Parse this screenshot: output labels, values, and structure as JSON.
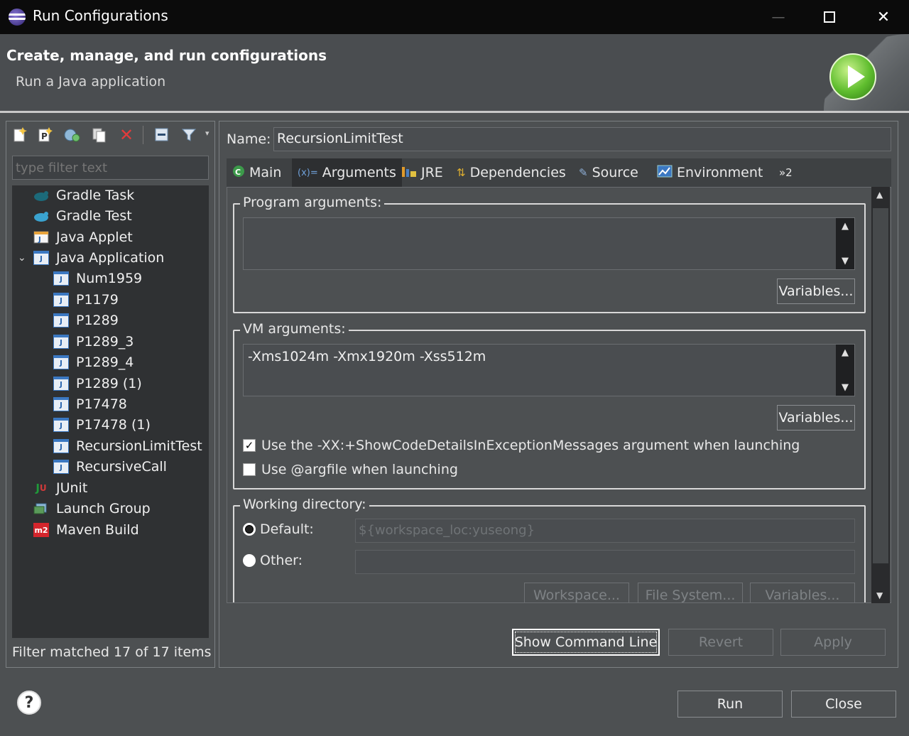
{
  "window": {
    "title": "Run Configurations",
    "min": "—",
    "max": "☐",
    "close": "✕"
  },
  "banner": {
    "title": "Create, manage, and run configurations",
    "subtitle": "Run a Java application"
  },
  "left": {
    "filter_placeholder": "type filter text",
    "toolbar": [
      "new-config-icon",
      "new-prototype-icon",
      "export-icon",
      "duplicate-icon",
      "delete-icon",
      "collapse-all-icon",
      "filter-icon"
    ],
    "tree": [
      {
        "label": "Gradle Task",
        "level": 1,
        "icon": "gradle-icon"
      },
      {
        "label": "Gradle Test",
        "level": 1,
        "icon": "gradle-icon"
      },
      {
        "label": "Java Applet",
        "level": 1,
        "icon": "applet-icon"
      },
      {
        "label": "Java Application",
        "level": 1,
        "icon": "java-app-icon",
        "expanded": true
      },
      {
        "label": "Num1959",
        "level": 2,
        "icon": "java-app-icon"
      },
      {
        "label": "P1179",
        "level": 2,
        "icon": "java-app-icon"
      },
      {
        "label": "P1289",
        "level": 2,
        "icon": "java-app-icon"
      },
      {
        "label": "P1289_3",
        "level": 2,
        "icon": "java-app-icon"
      },
      {
        "label": "P1289_4",
        "level": 2,
        "icon": "java-app-icon"
      },
      {
        "label": "P1289 (1)",
        "level": 2,
        "icon": "java-app-icon"
      },
      {
        "label": "P17478",
        "level": 2,
        "icon": "java-app-icon"
      },
      {
        "label": "P17478 (1)",
        "level": 2,
        "icon": "java-app-icon"
      },
      {
        "label": "RecursionLimitTest",
        "level": 2,
        "icon": "java-app-icon",
        "selected": true
      },
      {
        "label": "RecursiveCall",
        "level": 2,
        "icon": "java-app-icon"
      },
      {
        "label": "JUnit",
        "level": 1,
        "icon": "junit-icon"
      },
      {
        "label": "Launch Group",
        "level": 1,
        "icon": "launch-group-icon"
      },
      {
        "label": "Maven Build",
        "level": 1,
        "icon": "maven-icon"
      }
    ],
    "status": "Filter matched 17 of 17 items"
  },
  "right": {
    "name_label": "Name:",
    "name_value": "RecursionLimitTest",
    "tabs": [
      {
        "label": "Main",
        "icon": "main-tab-icon"
      },
      {
        "label": "Arguments",
        "icon": "arguments-tab-icon",
        "active": true
      },
      {
        "label": "JRE",
        "icon": "jre-tab-icon"
      },
      {
        "label": "Dependencies",
        "icon": "dependencies-tab-icon"
      },
      {
        "label": "Source",
        "icon": "source-tab-icon"
      },
      {
        "label": "Environment",
        "icon": "environment-tab-icon"
      }
    ],
    "tabs_overflow": "»2",
    "program_args": {
      "label": "Program arguments:",
      "value": "",
      "variables": "Variables..."
    },
    "vm_args": {
      "label": "VM arguments:",
      "value": "-Xms1024m -Xmx1920m -Xss512m",
      "variables": "Variables...",
      "check_showcode": {
        "label": "Use the -XX:+ShowCodeDetailsInExceptionMessages argument when launching",
        "checked": true
      },
      "check_argfile": {
        "label": "Use @argfile when launching",
        "checked": false
      }
    },
    "working_dir": {
      "label": "Working directory:",
      "default_label": "Default:",
      "default_value": "${workspace_loc:yuseong}",
      "default_selected": true,
      "other_label": "Other:",
      "other_value": "",
      "workspace_btn": "Workspace...",
      "filesystem_btn": "File System...",
      "variables_btn": "Variables..."
    },
    "buttons": {
      "show_cmd": "Show Command Line",
      "revert": "Revert",
      "apply": "Apply"
    }
  },
  "footer": {
    "help": "?",
    "run": "Run",
    "close": "Close"
  }
}
